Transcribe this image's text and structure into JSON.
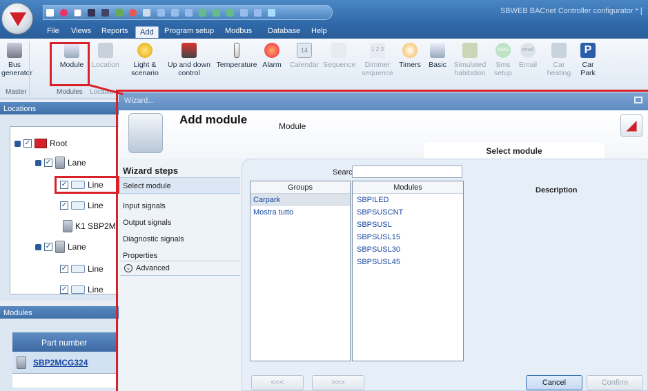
{
  "app": {
    "title": "SBWEB BACnet Controller configurator * ["
  },
  "menu_tabs": [
    {
      "label": "File"
    },
    {
      "label": "Views"
    },
    {
      "label": "Reports"
    },
    {
      "label": "Add"
    },
    {
      "label": "Program setup"
    },
    {
      "label": "Modbus"
    },
    {
      "label": "Database"
    },
    {
      "label": "Help"
    }
  ],
  "ribbon": {
    "buttons": [
      {
        "label": "Bus\ngenerator",
        "icon": "bus-generator-icon"
      },
      {
        "label": "Module",
        "icon": "module-icon"
      },
      {
        "label": "Location",
        "icon": "location-icon"
      },
      {
        "label": "Light &\nscenario",
        "icon": "lightbulb-icon"
      },
      {
        "label": "Up and down\ncontrol",
        "icon": "shutter-icon"
      },
      {
        "label": "Temperature",
        "icon": "thermometer-icon"
      },
      {
        "label": "Alarm",
        "icon": "alarm-icon"
      },
      {
        "label": "Calendar",
        "icon": "calendar-icon",
        "extra": "14"
      },
      {
        "label": "Sequence",
        "icon": "sequence-icon"
      },
      {
        "label": "Dimmer\nsequence",
        "icon": "dimmer-sequence-icon",
        "extra": "1 2 3"
      },
      {
        "label": "Timers",
        "icon": "timer-icon"
      },
      {
        "label": "Basic",
        "icon": "basic-icon"
      },
      {
        "label": "Simulated\nhabitation",
        "icon": "simulated-habitation-icon"
      },
      {
        "label": "Sms\nsetup",
        "icon": "sms-icon",
        "extra": "SMS"
      },
      {
        "label": "Email",
        "icon": "email-icon",
        "extra": "email"
      },
      {
        "label": "Car\nheating",
        "icon": "car-heating-icon"
      },
      {
        "label": "Car\nPark",
        "icon": "car-park-icon",
        "extra": "P"
      }
    ],
    "groups": {
      "master": "Master",
      "modules": "Modules",
      "location": "Location"
    }
  },
  "locations_panel": {
    "title": "Locations",
    "tree": [
      {
        "label": "Root"
      },
      {
        "label": "Lane"
      },
      {
        "label": "Line"
      },
      {
        "label": "Line"
      },
      {
        "label": "K1 SBP2M"
      },
      {
        "label": "Lane"
      },
      {
        "label": "Line"
      },
      {
        "label": "Line"
      }
    ]
  },
  "modules_panel": {
    "title": "Modules",
    "column_header": "Part number",
    "rows": [
      {
        "part_number": "SBP2MCG324"
      }
    ]
  },
  "wizard": {
    "window_title": "Wizard...",
    "title": "Add module",
    "subtitle": "Module",
    "section_title": "Select module",
    "steps_title": "Wizard steps",
    "steps": [
      "Select module",
      "Input signals",
      "Output signals",
      "Diagnostic signals",
      "Properties"
    ],
    "advanced_label": "Advanced",
    "search_label": "Search",
    "search_value": "",
    "groups_header": "Groups",
    "groups": [
      "Carpark",
      "Mostra tutto"
    ],
    "modules_header": "Modules",
    "modules": [
      "SBPILED",
      "SBPSUSCNT",
      "SBPSUSL",
      "SBPSUSL15",
      "SBPSUSL30",
      "SBPSUSL45"
    ],
    "description_header": "Description",
    "prev_label": "<<<",
    "next_label": ">>>",
    "cancel_label": "Cancel",
    "confirm_label": "Confirm"
  },
  "colors": {
    "accent": "#2f68a8",
    "highlight": "#d8222a",
    "brand_red": "#d0202a"
  }
}
